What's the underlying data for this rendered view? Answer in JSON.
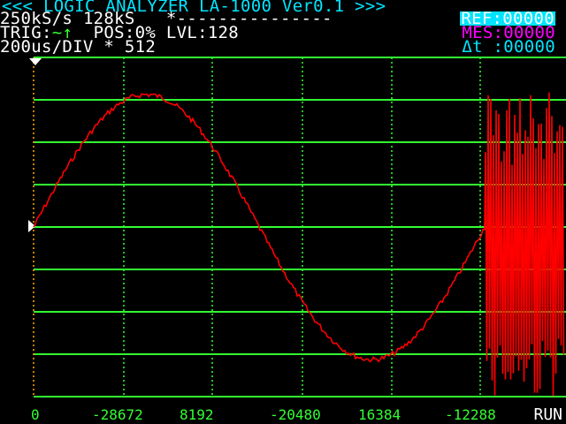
{
  "header": {
    "title": "<<< LOGIC ANALYZER LA-1000 Ver0.1 >>>",
    "sample_rate": "250kS/s",
    "sample_count": "128kS",
    "pattern": "*---------------",
    "trigger_label": "TRIG:",
    "trigger_symbol": "~↑",
    "position": "POS:0%",
    "level": "LVL:128",
    "timebase": "200us/DIV * 512"
  },
  "markers": {
    "ref": "REF:00000",
    "mes": "MES:00000",
    "delta": "Δt :00000"
  },
  "x_axis": {
    "tick_labels": [
      "0",
      "-28672",
      "8192",
      "-20480",
      "16384",
      "-12288"
    ]
  },
  "status": "RUN",
  "colors": {
    "grid": "#33ff33",
    "trace": "#ff0000",
    "title": "#00e5ff",
    "mes": "#ff00ff"
  },
  "icons": {
    "trigger_marker": "triangle-down-icon",
    "level_marker": "triangle-right-icon"
  }
}
